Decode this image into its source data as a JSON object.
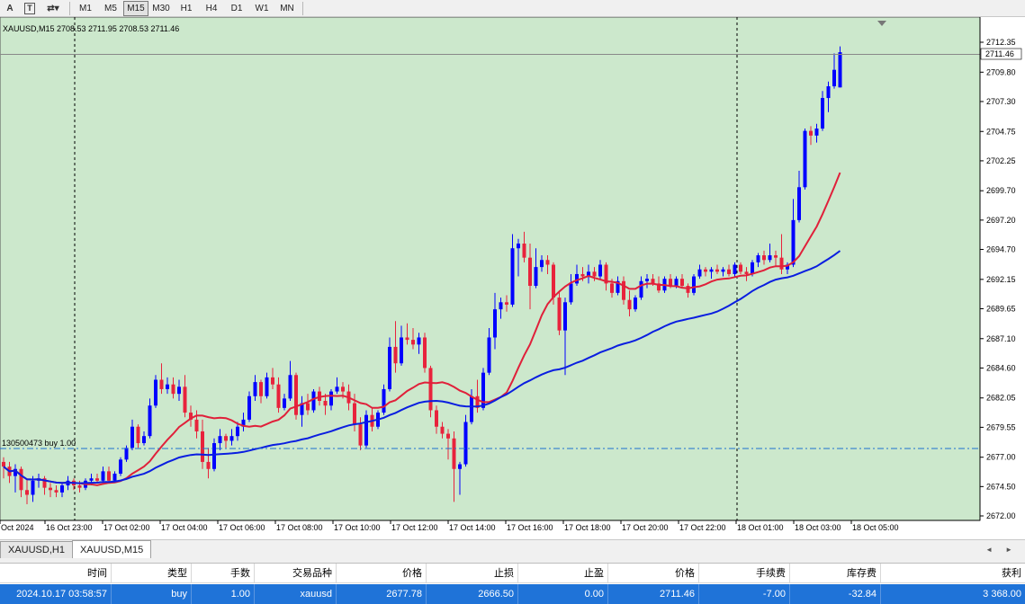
{
  "toolbar": {
    "tools": [
      {
        "name": "text-tool-icon",
        "glyph": "A"
      },
      {
        "name": "text-label-tool-icon",
        "glyph": "T"
      },
      {
        "name": "arrows-tool-icon",
        "glyph": "⇄▾"
      }
    ],
    "timeframes": [
      "M1",
      "M5",
      "M15",
      "M30",
      "H1",
      "H4",
      "D1",
      "W1",
      "MN"
    ],
    "active_timeframe": "M15"
  },
  "chart_info": "XAUUSD,M15  2708.53 2711.95 2708.53 2711.46",
  "order_line_label": "130500473 buy 1.00",
  "price_axis": {
    "labels": [
      "2712.35",
      "2709.80",
      "2707.30",
      "2704.75",
      "2702.25",
      "2699.70",
      "2697.20",
      "2694.70",
      "2692.15",
      "2689.65",
      "2687.10",
      "2684.60",
      "2682.05",
      "2679.55",
      "2677.00",
      "2674.50",
      "2672.00"
    ],
    "current_price": "2711.46"
  },
  "time_axis": {
    "labels": [
      "Oct 2024",
      "16 Oct 23:00",
      "17 Oct 02:00",
      "17 Oct 04:00",
      "17 Oct 06:00",
      "17 Oct 08:00",
      "17 Oct 10:00",
      "17 Oct 12:00",
      "17 Oct 14:00",
      "17 Oct 16:00",
      "17 Oct 18:00",
      "17 Oct 20:00",
      "17 Oct 22:00",
      "18 Oct 01:00",
      "18 Oct 03:00",
      "18 Oct 05:00"
    ]
  },
  "chart_tabs": {
    "items": [
      "XAUUSD,H1",
      "XAUUSD,M15"
    ],
    "active": "XAUUSD,M15",
    "scroll_left": "◄",
    "scroll_right": "►"
  },
  "terminal": {
    "columns": [
      "时间",
      "类型",
      "手数",
      "交易品种",
      "价格",
      "止损",
      "止盈",
      "价格",
      "手续费",
      "库存费",
      "获利"
    ],
    "rows": [
      [
        "2024.10.17 03:58:57",
        "buy",
        "1.00",
        "xauusd",
        "2677.78",
        "2666.50",
        "0.00",
        "2711.46",
        "-7.00",
        "-32.84",
        "3 368.00"
      ]
    ]
  },
  "colors": {
    "chart_bg": "#cce8cc",
    "bull": "#0000ff",
    "bear": "#e8233c",
    "ma_fast": "#e0203a",
    "ma_slow": "#0a1ee0",
    "order_line": "#1e6fd0",
    "selected_row": "#1f73d8"
  },
  "chart_data": {
    "type": "candlestick",
    "symbol": "XAUUSD",
    "timeframe": "M15",
    "ylim": [
      2672.0,
      2713.5
    ],
    "candles": [
      [
        2676.6,
        2677.0,
        2675.2,
        2676.2
      ],
      [
        2676.2,
        2676.6,
        2674.8,
        2675.4
      ],
      [
        2675.4,
        2676.4,
        2674.0,
        2676.0
      ],
      [
        2676.0,
        2676.2,
        2673.6,
        2674.2
      ],
      [
        2674.2,
        2675.2,
        2673.0,
        2673.8
      ],
      [
        2673.8,
        2675.4,
        2673.2,
        2675.0
      ],
      [
        2675.0,
        2675.6,
        2674.4,
        2675.2
      ],
      [
        2675.2,
        2675.4,
        2673.8,
        2674.4
      ],
      [
        2674.4,
        2674.8,
        2673.6,
        2674.2
      ],
      [
        2674.2,
        2674.6,
        2673.6,
        2674.0
      ],
      [
        2674.0,
        2674.8,
        2673.6,
        2674.6
      ],
      [
        2674.6,
        2675.4,
        2674.2,
        2675.0
      ],
      [
        2675.0,
        2675.2,
        2674.2,
        2674.6
      ],
      [
        2674.6,
        2675.0,
        2674.0,
        2674.4
      ],
      [
        2674.4,
        2675.2,
        2674.2,
        2675.0
      ],
      [
        2675.0,
        2675.6,
        2674.6,
        2675.2
      ],
      [
        2675.2,
        2675.6,
        2674.8,
        2675.0
      ],
      [
        2675.0,
        2676.2,
        2674.8,
        2675.8
      ],
      [
        2675.8,
        2676.2,
        2674.8,
        2675.0
      ],
      [
        2675.0,
        2675.8,
        2674.8,
        2675.6
      ],
      [
        2675.6,
        2677.0,
        2675.4,
        2676.8
      ],
      [
        2676.8,
        2678.0,
        2676.6,
        2677.8
      ],
      [
        2677.8,
        2680.2,
        2677.6,
        2679.6
      ],
      [
        2679.6,
        2679.8,
        2677.8,
        2678.2
      ],
      [
        2678.2,
        2679.2,
        2678.0,
        2678.8
      ],
      [
        2678.8,
        2682.0,
        2678.6,
        2681.4
      ],
      [
        2681.4,
        2684.0,
        2681.2,
        2683.6
      ],
      [
        2683.6,
        2685.0,
        2682.4,
        2682.8
      ],
      [
        2682.8,
        2683.8,
        2682.4,
        2683.2
      ],
      [
        2683.2,
        2683.8,
        2682.0,
        2682.4
      ],
      [
        2682.4,
        2683.6,
        2681.8,
        2683.0
      ],
      [
        2683.0,
        2684.0,
        2680.4,
        2680.8
      ],
      [
        2680.8,
        2681.4,
        2679.6,
        2680.2
      ],
      [
        2680.2,
        2681.0,
        2678.6,
        2679.2
      ],
      [
        2679.2,
        2680.2,
        2676.0,
        2676.6
      ],
      [
        2676.6,
        2677.8,
        2675.2,
        2676.0
      ],
      [
        2676.0,
        2678.6,
        2675.8,
        2678.2
      ],
      [
        2678.2,
        2679.4,
        2677.6,
        2678.8
      ],
      [
        2678.8,
        2679.0,
        2677.8,
        2678.4
      ],
      [
        2678.4,
        2679.4,
        2678.0,
        2678.8
      ],
      [
        2678.8,
        2680.0,
        2678.4,
        2679.6
      ],
      [
        2679.6,
        2680.8,
        2679.2,
        2680.2
      ],
      [
        2680.2,
        2682.6,
        2680.0,
        2682.2
      ],
      [
        2682.2,
        2684.0,
        2681.8,
        2683.4
      ],
      [
        2683.4,
        2683.6,
        2681.6,
        2682.2
      ],
      [
        2682.2,
        2684.2,
        2682.0,
        2683.8
      ],
      [
        2683.8,
        2684.6,
        2682.8,
        2683.2
      ],
      [
        2683.2,
        2683.8,
        2680.8,
        2681.2
      ],
      [
        2681.2,
        2682.4,
        2681.0,
        2682.0
      ],
      [
        2682.0,
        2685.2,
        2681.8,
        2684.0
      ],
      [
        2684.0,
        2684.2,
        2680.2,
        2680.6
      ],
      [
        2680.6,
        2682.2,
        2679.6,
        2681.6
      ],
      [
        2681.6,
        2682.4,
        2680.6,
        2681.0
      ],
      [
        2681.0,
        2682.8,
        2680.8,
        2682.6
      ],
      [
        2682.6,
        2683.0,
        2681.4,
        2681.8
      ],
      [
        2681.8,
        2682.4,
        2680.6,
        2681.4
      ],
      [
        2681.4,
        2682.8,
        2681.0,
        2682.6
      ],
      [
        2682.6,
        2683.8,
        2682.4,
        2683.0
      ],
      [
        2683.0,
        2683.4,
        2682.0,
        2682.6
      ],
      [
        2682.6,
        2683.2,
        2681.0,
        2681.6
      ],
      [
        2681.6,
        2682.4,
        2679.2,
        2679.8
      ],
      [
        2679.8,
        2680.4,
        2677.6,
        2678.0
      ],
      [
        2678.0,
        2681.0,
        2677.8,
        2680.6
      ],
      [
        2680.6,
        2681.2,
        2679.2,
        2679.6
      ],
      [
        2679.6,
        2681.0,
        2679.4,
        2680.8
      ],
      [
        2680.8,
        2683.2,
        2680.6,
        2682.8
      ],
      [
        2682.8,
        2687.2,
        2682.6,
        2686.4
      ],
      [
        2686.4,
        2688.6,
        2684.2,
        2685.0
      ],
      [
        2685.0,
        2688.2,
        2684.8,
        2687.2
      ],
      [
        2687.2,
        2688.4,
        2686.6,
        2687.0
      ],
      [
        2687.0,
        2688.0,
        2686.2,
        2686.6
      ],
      [
        2686.6,
        2687.6,
        2685.8,
        2687.2
      ],
      [
        2687.2,
        2687.6,
        2684.2,
        2684.6
      ],
      [
        2684.6,
        2684.8,
        2680.4,
        2681.0
      ],
      [
        2681.0,
        2681.4,
        2679.0,
        2679.6
      ],
      [
        2679.6,
        2680.0,
        2678.6,
        2679.0
      ],
      [
        2679.0,
        2679.4,
        2676.8,
        2678.6
      ],
      [
        2678.6,
        2679.2,
        2673.2,
        2676.0
      ],
      [
        2676.0,
        2676.6,
        2673.8,
        2676.4
      ],
      [
        2676.4,
        2680.6,
        2676.2,
        2680.0
      ],
      [
        2680.0,
        2682.8,
        2679.8,
        2682.2
      ],
      [
        2682.2,
        2683.6,
        2680.8,
        2681.2
      ],
      [
        2681.2,
        2684.6,
        2681.0,
        2684.2
      ],
      [
        2684.2,
        2688.0,
        2684.0,
        2687.2
      ],
      [
        2687.2,
        2691.0,
        2686.2,
        2689.6
      ],
      [
        2689.6,
        2690.6,
        2688.8,
        2690.2
      ],
      [
        2690.2,
        2690.8,
        2689.4,
        2690.0
      ],
      [
        2690.0,
        2696.0,
        2689.8,
        2694.8
      ],
      [
        2694.8,
        2695.6,
        2692.4,
        2695.2
      ],
      [
        2695.2,
        2696.2,
        2693.6,
        2694.0
      ],
      [
        2694.0,
        2695.2,
        2689.6,
        2691.6
      ],
      [
        2691.6,
        2694.8,
        2691.4,
        2693.2
      ],
      [
        2693.2,
        2694.2,
        2692.8,
        2693.8
      ],
      [
        2693.8,
        2694.2,
        2692.6,
        2693.4
      ],
      [
        2693.4,
        2693.6,
        2690.0,
        2690.6
      ],
      [
        2690.6,
        2691.2,
        2687.4,
        2687.8
      ],
      [
        2687.8,
        2690.6,
        2684.0,
        2690.2
      ],
      [
        2690.2,
        2692.6,
        2690.0,
        2691.8
      ],
      [
        2691.8,
        2693.4,
        2691.6,
        2692.6
      ],
      [
        2692.6,
        2693.2,
        2692.0,
        2692.4
      ],
      [
        2692.4,
        2693.4,
        2691.8,
        2692.8
      ],
      [
        2692.8,
        2693.2,
        2692.0,
        2692.4
      ],
      [
        2692.4,
        2693.8,
        2692.2,
        2693.4
      ],
      [
        2693.4,
        2693.6,
        2691.2,
        2691.8
      ],
      [
        2691.8,
        2692.2,
        2690.6,
        2691.0
      ],
      [
        2691.0,
        2692.4,
        2690.8,
        2692.0
      ],
      [
        2692.0,
        2692.4,
        2690.0,
        2690.4
      ],
      [
        2690.4,
        2691.2,
        2689.0,
        2689.6
      ],
      [
        2689.6,
        2690.8,
        2689.4,
        2690.6
      ],
      [
        2690.6,
        2692.4,
        2690.4,
        2692.0
      ],
      [
        2692.0,
        2692.6,
        2691.4,
        2692.2
      ],
      [
        2692.2,
        2692.6,
        2691.6,
        2691.8
      ],
      [
        2691.8,
        2692.4,
        2691.0,
        2691.2
      ],
      [
        2691.2,
        2692.4,
        2691.0,
        2692.2
      ],
      [
        2692.2,
        2692.6,
        2691.4,
        2691.6
      ],
      [
        2691.6,
        2692.4,
        2691.4,
        2692.2
      ],
      [
        2692.2,
        2692.6,
        2691.4,
        2691.6
      ],
      [
        2691.6,
        2691.8,
        2690.6,
        2691.0
      ],
      [
        2691.0,
        2692.6,
        2690.8,
        2692.4
      ],
      [
        2692.4,
        2693.4,
        2692.2,
        2693.0
      ],
      [
        2693.0,
        2693.2,
        2692.4,
        2692.8
      ],
      [
        2692.8,
        2693.2,
        2692.2,
        2693.0
      ],
      [
        2693.0,
        2693.4,
        2692.6,
        2692.8
      ],
      [
        2692.8,
        2693.2,
        2692.4,
        2693.0
      ],
      [
        2693.0,
        2693.4,
        2692.4,
        2692.6
      ],
      [
        2692.6,
        2693.6,
        2692.4,
        2693.4
      ],
      [
        2693.4,
        2693.6,
        2692.6,
        2692.8
      ],
      [
        2692.8,
        2693.2,
        2692.0,
        2692.6
      ],
      [
        2692.6,
        2693.8,
        2692.4,
        2693.6
      ],
      [
        2693.6,
        2694.4,
        2693.2,
        2694.2
      ],
      [
        2694.2,
        2694.6,
        2693.4,
        2693.8
      ],
      [
        2693.8,
        2695.2,
        2693.6,
        2694.2
      ],
      [
        2694.2,
        2694.6,
        2693.2,
        2694.0
      ],
      [
        2694.0,
        2696.0,
        2692.6,
        2693.0
      ],
      [
        2693.0,
        2693.6,
        2692.6,
        2693.4
      ],
      [
        2693.4,
        2699.0,
        2693.2,
        2697.2
      ],
      [
        2697.2,
        2701.4,
        2697.0,
        2700.0
      ],
      [
        2700.0,
        2705.0,
        2699.8,
        2704.8
      ],
      [
        2704.8,
        2705.2,
        2703.6,
        2704.4
      ],
      [
        2704.4,
        2705.4,
        2703.8,
        2705.0
      ],
      [
        2705.0,
        2708.2,
        2704.8,
        2707.6
      ],
      [
        2707.6,
        2709.0,
        2706.4,
        2708.6
      ],
      [
        2708.6,
        2711.4,
        2708.4,
        2710.0
      ],
      [
        2708.5,
        2712.0,
        2708.5,
        2711.5
      ]
    ]
  }
}
